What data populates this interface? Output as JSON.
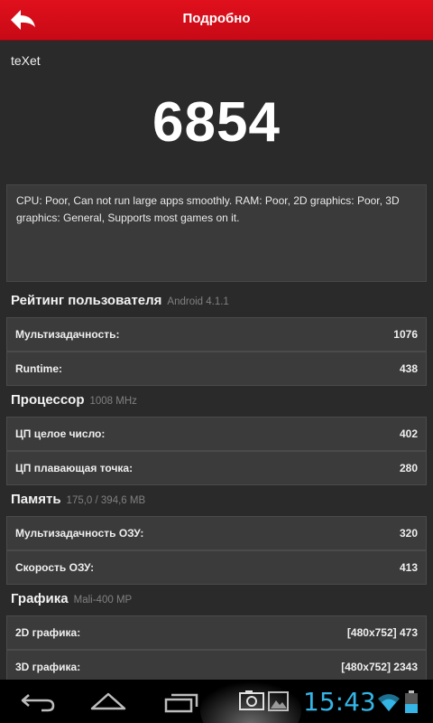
{
  "header": {
    "title": "Подробно"
  },
  "device": {
    "name": "teXet"
  },
  "score": "6854",
  "description": "CPU: Poor, Can not run large apps smoothly. RAM: Poor, 2D graphics: Poor, 3D graphics: General, Supports most games on it.",
  "sections": [
    {
      "title": "Рейтинг пользователя",
      "sub": "Android 4.1.1",
      "rows": [
        {
          "label": "Мультизадачность:",
          "value": "1076"
        },
        {
          "label": "Runtime:",
          "value": "438"
        }
      ]
    },
    {
      "title": "Процессор",
      "sub": "1008 MHz",
      "rows": [
        {
          "label": "ЦП целое число:",
          "value": "402"
        },
        {
          "label": "ЦП плавающая точка:",
          "value": "280"
        }
      ]
    },
    {
      "title": "Память",
      "sub": "175,0 / 394,6 MB",
      "rows": [
        {
          "label": "Мультизадачность ОЗУ:",
          "value": "320"
        },
        {
          "label": "Скорость ОЗУ:",
          "value": "413"
        }
      ]
    },
    {
      "title": "Графика",
      "sub": "Mali-400 MP",
      "rows": [
        {
          "label": "2D графика:",
          "value": "[480x752] 473"
        },
        {
          "label": "3D графика:",
          "value": "[480x752] 2343"
        }
      ]
    }
  ],
  "statusbar": {
    "time": "15:43"
  },
  "icons": {
    "back": "arrow-back-icon",
    "nav_back": "nav-back-icon",
    "nav_home": "nav-home-icon",
    "nav_recent": "nav-recent-apps-icon",
    "screenshot": "screenshot-icon",
    "gallery": "gallery-icon",
    "wifi": "wifi-icon",
    "battery": "battery-icon"
  },
  "colors": {
    "accent": "#d50f1b",
    "clock": "#34b5e5",
    "background": "#2a2a2a"
  }
}
